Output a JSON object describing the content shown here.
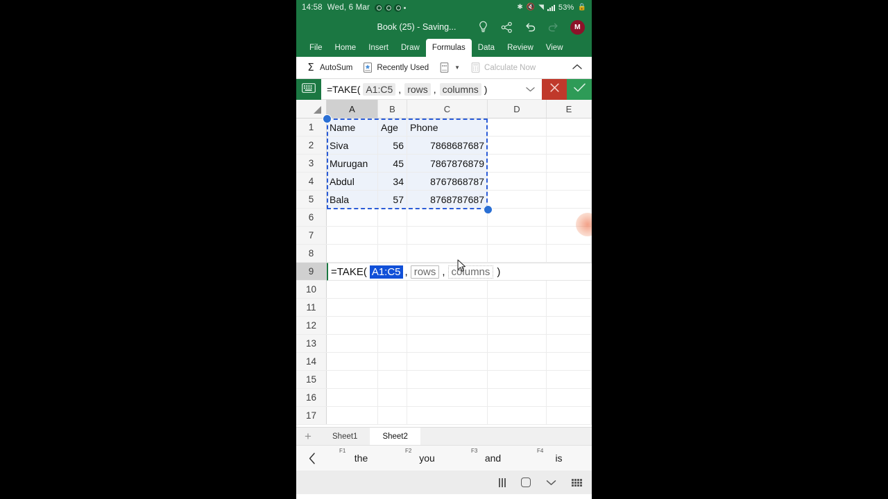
{
  "status_bar": {
    "time": "14:58",
    "date": "Wed, 6 Mar",
    "battery": "53%",
    "icons": [
      "app-notification-icon",
      "app-notification-icon",
      "app-notification-icon",
      "dot-icon",
      "bluetooth-icon",
      "mute-icon",
      "wifi-icon",
      "signal-icon",
      "lock-icon"
    ]
  },
  "title_bar": {
    "document_title": "Book (25) - Saving...",
    "tell_me_icon": "lightbulb-icon",
    "share_icon": "share-icon",
    "undo_icon": "undo-icon",
    "redo_icon": "redo-icon",
    "avatar_initial": "M"
  },
  "ribbon": {
    "tabs": [
      {
        "label": "File",
        "active": false
      },
      {
        "label": "Home",
        "active": false
      },
      {
        "label": "Insert",
        "active": false
      },
      {
        "label": "Draw",
        "active": false
      },
      {
        "label": "Formulas",
        "active": true
      },
      {
        "label": "Data",
        "active": false
      },
      {
        "label": "Review",
        "active": false
      },
      {
        "label": "View",
        "active": false
      }
    ],
    "commands": [
      {
        "label": "AutoSum",
        "icon": "sigma-icon",
        "disabled": false
      },
      {
        "label": "Recently Used",
        "icon": "recently-used-icon",
        "disabled": false
      },
      {
        "label": "",
        "icon": "more-functions-icon",
        "disabled": false
      },
      {
        "label": "Calculate Now",
        "icon": "calculator-icon",
        "disabled": true
      }
    ],
    "collapse_icon": "chevron-up-icon"
  },
  "formula_bar": {
    "keyboard_icon": "keyboard-icon",
    "prefix": "=TAKE(",
    "arg_range": "A1:C5",
    "comma1": ",",
    "arg_rows": "rows",
    "comma2": ",",
    "arg_columns": "columns",
    "suffix": ")",
    "expand_icon": "chevron-down-icon",
    "cancel_icon": "close-icon",
    "confirm_icon": "check-icon",
    "cancel_color": "#C0392B",
    "confirm_color": "#2E9B57"
  },
  "grid": {
    "columns": [
      "A",
      "B",
      "C",
      "D",
      "E"
    ],
    "selected_column": "A",
    "rows": [
      "1",
      "2",
      "3",
      "4",
      "5",
      "6",
      "7",
      "8",
      "9",
      "10",
      "11",
      "12",
      "13",
      "14",
      "15",
      "16",
      "17"
    ],
    "selected_row": "9",
    "data": [
      {
        "row": "1",
        "a": "Name",
        "b": "Age",
        "c": "Phone",
        "numeric": false
      },
      {
        "row": "2",
        "a": "Siva",
        "b": "56",
        "c": "7868687687",
        "numeric": true
      },
      {
        "row": "3",
        "a": "Murugan",
        "b": "45",
        "c": "7867876879",
        "numeric": true
      },
      {
        "row": "4",
        "a": "Abdul",
        "b": "34",
        "c": "8767868787",
        "numeric": true
      },
      {
        "row": "5",
        "a": "Bala",
        "b": "57",
        "c": "8768787687",
        "numeric": true
      }
    ],
    "selection_range": "A1:C5",
    "selection_color": "#2a5bd7",
    "handle_color": "#2a6fd4"
  },
  "edit_cell": {
    "row": "9",
    "prefix": "=TAKE(",
    "selected_token": "A1:C5",
    "comma1": ",",
    "arg_rows": "rows",
    "comma2": ",",
    "arg_columns": "columns",
    "suffix": ")",
    "highlight_color": "#1150d8"
  },
  "sheet_bar": {
    "add_label": "+",
    "tabs": [
      {
        "label": "Sheet1",
        "active": false
      },
      {
        "label": "Sheet2",
        "active": true
      }
    ]
  },
  "predictive_bar": {
    "back_icon": "chevron-left-icon",
    "suggestions": [
      {
        "fkey": "F1",
        "word": "the"
      },
      {
        "fkey": "F2",
        "word": "you"
      },
      {
        "fkey": "F3",
        "word": "and"
      },
      {
        "fkey": "F4",
        "word": "is"
      }
    ]
  },
  "nav_bar": {
    "recents_icon": "recents-icon",
    "home_icon": "home-icon",
    "hide_keyboard_icon": "chevron-down-icon",
    "keyboard_switch_icon": "keyboard-switch-icon"
  }
}
